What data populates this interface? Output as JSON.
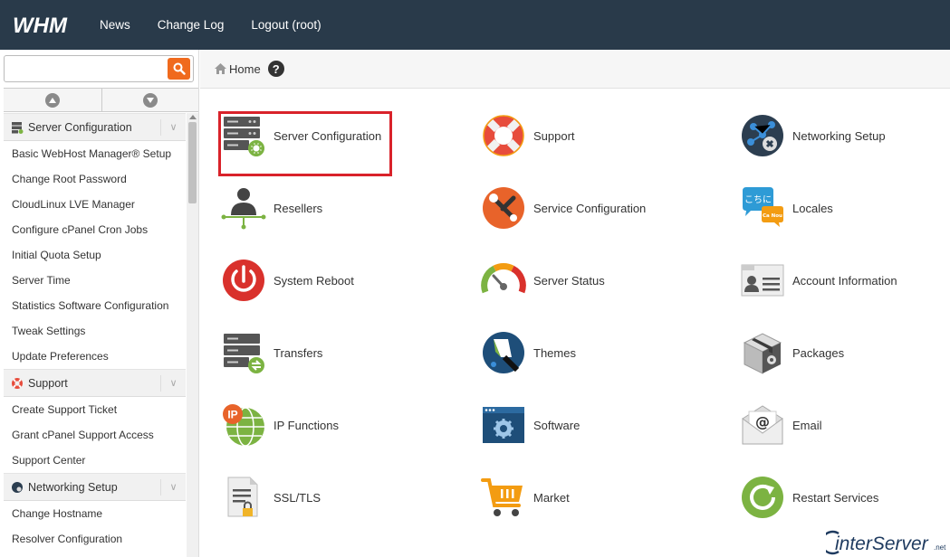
{
  "topbar": {
    "logo": "WHM",
    "nav": [
      "News",
      "Change Log",
      "Logout (root)"
    ]
  },
  "sidebar": {
    "search": {
      "value": "",
      "placeholder": ""
    },
    "categories": [
      {
        "label": "Server Configuration",
        "items": [
          "Basic WebHost Manager® Setup",
          "Change Root Password",
          "CloudLinux LVE Manager",
          "Configure cPanel Cron Jobs",
          "Initial Quota Setup",
          "Server Time",
          "Statistics Software Configuration",
          "Tweak Settings",
          "Update Preferences"
        ]
      },
      {
        "label": "Support",
        "items": [
          "Create Support Ticket",
          "Grant cPanel Support Access",
          "Support Center"
        ]
      },
      {
        "label": "Networking Setup",
        "items": [
          "Change Hostname",
          "Resolver Configuration"
        ]
      }
    ],
    "chevron": "∨"
  },
  "breadcrumb": {
    "home": "Home",
    "help": "?"
  },
  "tiles": [
    "Server Configuration",
    "Support",
    "Networking Setup",
    "Resellers",
    "Service Configuration",
    "Locales",
    "System Reboot",
    "Server Status",
    "Account Information",
    "Transfers",
    "Themes",
    "Packages",
    "IP Functions",
    "Software",
    "Email",
    "SSL/TLS",
    "Market",
    "Restart Services"
  ],
  "locales_icon_text": {
    "top": "こちに",
    "bottom": "Ca Nou"
  },
  "ip_icon_text": "IP",
  "brand": {
    "main": "interServer",
    "suffix": ".net"
  },
  "colors": {
    "topbar": "#293a4a",
    "accent": "#f06a1d",
    "highlight": "#d9222a"
  }
}
